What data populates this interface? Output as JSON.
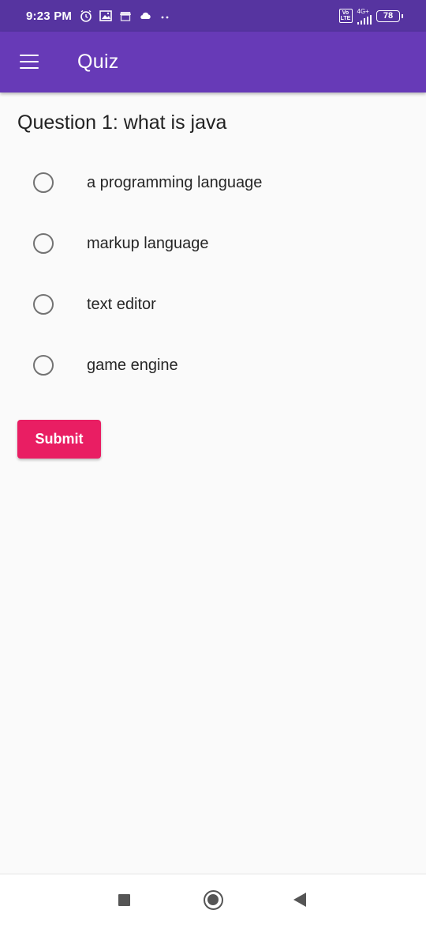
{
  "status_bar": {
    "time": "9:23 PM",
    "left_icons": [
      "alarm-icon",
      "photo-icon",
      "store-icon",
      "cloud-icon",
      "more-dots-icon"
    ],
    "volte": "Vo LTE",
    "network": "4G+",
    "battery": "78"
  },
  "app_bar": {
    "title": "Quiz",
    "menu_icon": "hamburger-menu-icon"
  },
  "quiz": {
    "question": "Question 1: what is java",
    "options": [
      {
        "label": "a programming language",
        "selected": false
      },
      {
        "label": "markup language",
        "selected": false
      },
      {
        "label": "text editor",
        "selected": false
      },
      {
        "label": "game engine",
        "selected": false
      }
    ],
    "submit_label": "Submit"
  },
  "colors": {
    "status_bar": "#5634a0",
    "app_bar": "#673ab7",
    "submit": "#e91e63",
    "background": "#fafafa"
  },
  "nav_bar": {
    "icons": [
      "recents-square-icon",
      "home-circle-icon",
      "back-triangle-icon"
    ]
  }
}
